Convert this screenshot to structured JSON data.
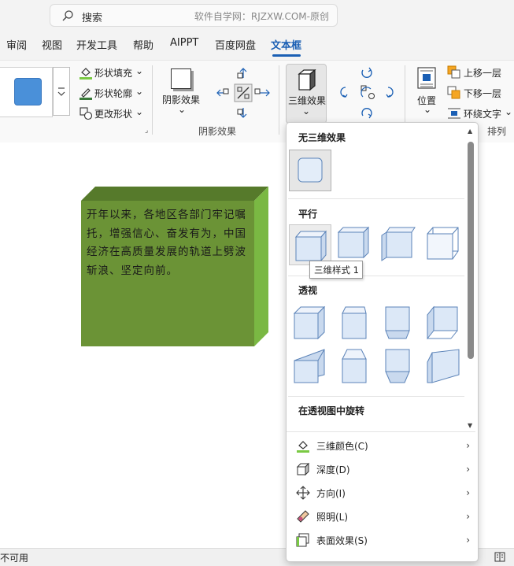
{
  "search": {
    "label": "搜索",
    "hint": "软件自学网：RJZXW.COM-原创"
  },
  "tabs": [
    {
      "label": "审阅"
    },
    {
      "label": "视图"
    },
    {
      "label": "开发工具"
    },
    {
      "label": "帮助"
    },
    {
      "label": "AIPPT"
    },
    {
      "label": "百度网盘"
    },
    {
      "label": "文本框",
      "active": true
    }
  ],
  "ribbon": {
    "shape_fill": "形状填充",
    "shape_outline": "形状轮廓",
    "change_shape": "更改形状",
    "shadow_effect": "阴影效果",
    "shadow_group": "阴影效果",
    "threed_effect": "三维效果",
    "position": "位置",
    "bring_forward": "上移一层",
    "send_backward": "下移一层",
    "wrap_text": "环绕文字",
    "arrange_group": "排列"
  },
  "document": {
    "text": "开年以来，各地区各部门牢记嘱托，增强信心、奋发有为，中国经济在高质量发展的轨道上劈波斩浪、坚定向前。",
    "box_color": "#6b9336"
  },
  "menu": {
    "sections": [
      "无三维效果",
      "平行",
      "透视",
      "在透视图中旋转"
    ],
    "tooltip": "三维样式 1",
    "commands": [
      {
        "label": "三维颜色(C)",
        "icon": "paint-bucket-icon"
      },
      {
        "label": "深度(D)",
        "icon": "depth-icon"
      },
      {
        "label": "方向(I)",
        "icon": "direction-icon"
      },
      {
        "label": "照明(L)",
        "icon": "lighting-icon"
      },
      {
        "label": "表面效果(S)",
        "icon": "surface-icon"
      }
    ]
  },
  "status": {
    "left": "不可用"
  },
  "colors": {
    "accent": "#1a5fb4",
    "shape_preview": "#4a90d9",
    "fill_bar": "#7ac943"
  }
}
